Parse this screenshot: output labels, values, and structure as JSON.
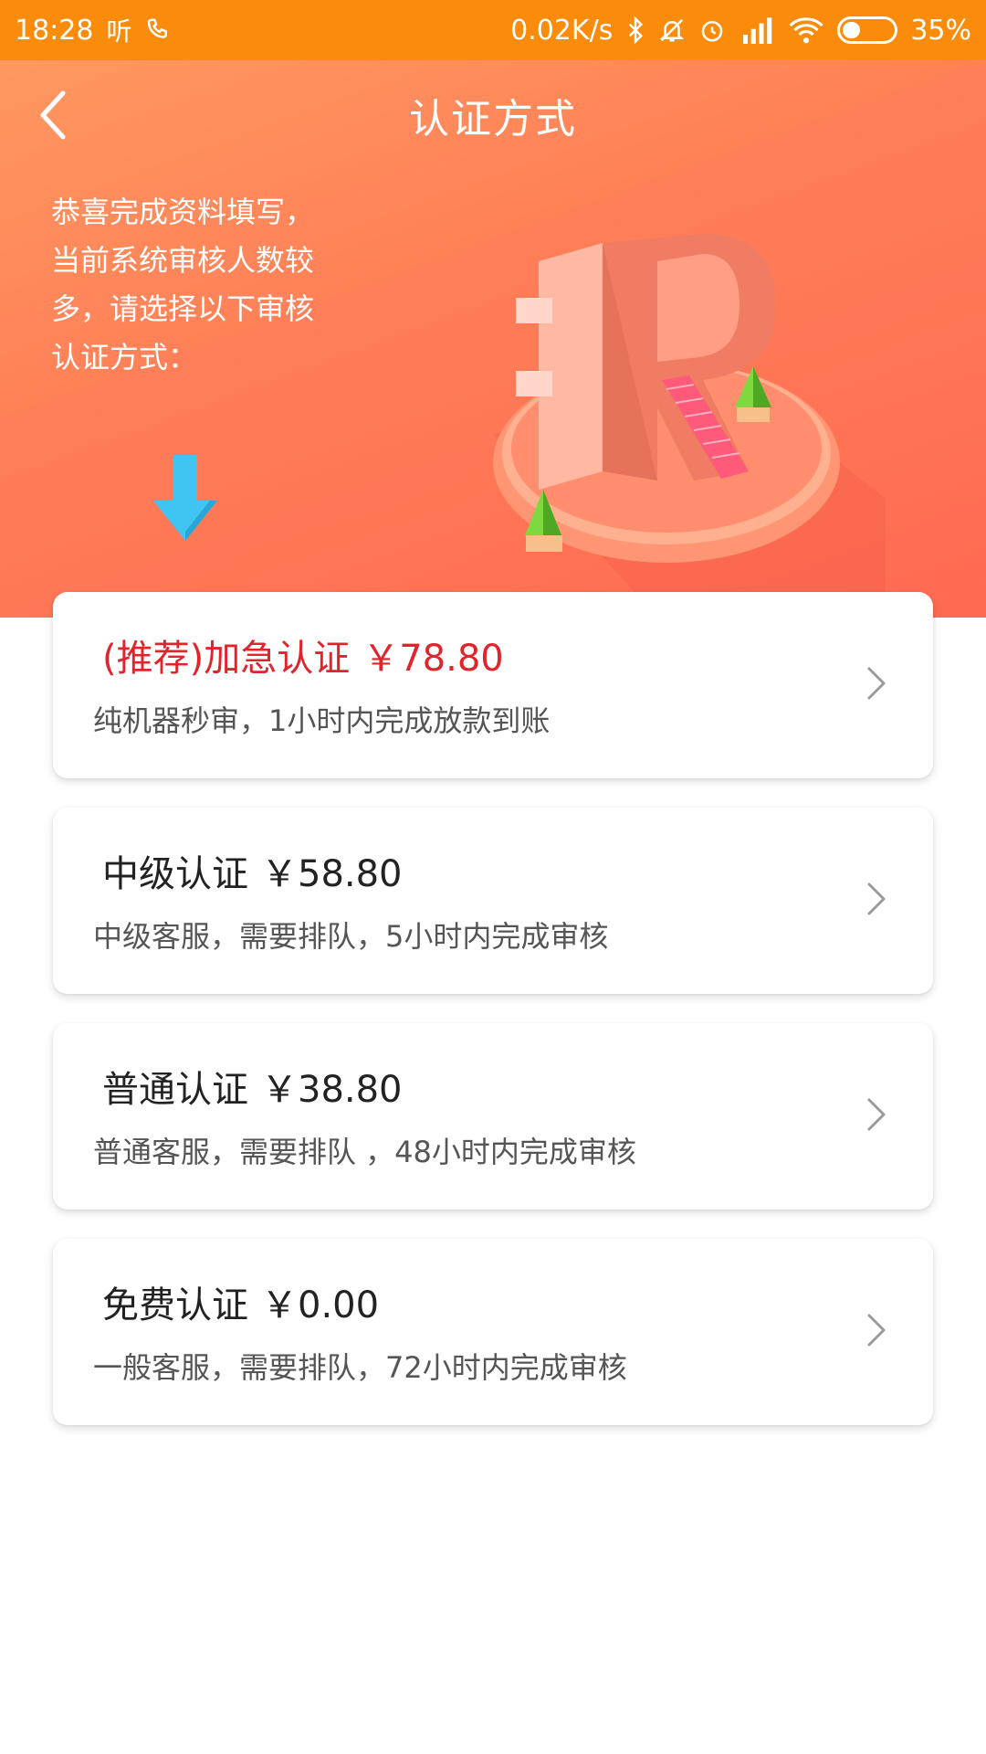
{
  "status_bar": {
    "time": "18:28",
    "app_icon_1": "听",
    "network_speed": "0.02K/s",
    "battery_percent": "35%",
    "battery_level": 0.35,
    "bg_color": "#fb8c0b"
  },
  "header": {
    "title": "认证方式",
    "back_icon": "chevron-left-icon"
  },
  "hero": {
    "message": "恭喜完成资料填写，当前系统审核人数较多，请选择以下审核认证方式：",
    "arrow_icon": "arrow-down-icon",
    "illustration": "letter-r-illustration",
    "gradient_start": "#ff9860",
    "gradient_end": "#ff6a52"
  },
  "options": [
    {
      "title": "(推荐)加急认证",
      "price": "￥78.80",
      "description": "纯机器秒审，1小时内完成放款到账",
      "recommended": true,
      "accent_color": "#e0242c"
    },
    {
      "title": "中级认证",
      "price": "￥58.80",
      "description": "中级客服，需要排队，5小时内完成审核",
      "recommended": false
    },
    {
      "title": "普通认证",
      "price": "￥38.80",
      "description": "普通客服，需要排队 ，48小时内完成审核",
      "recommended": false
    },
    {
      "title": "免费认证",
      "price": "￥0.00",
      "description": "一般客服，需要排队，72小时内完成审核",
      "recommended": false
    }
  ]
}
